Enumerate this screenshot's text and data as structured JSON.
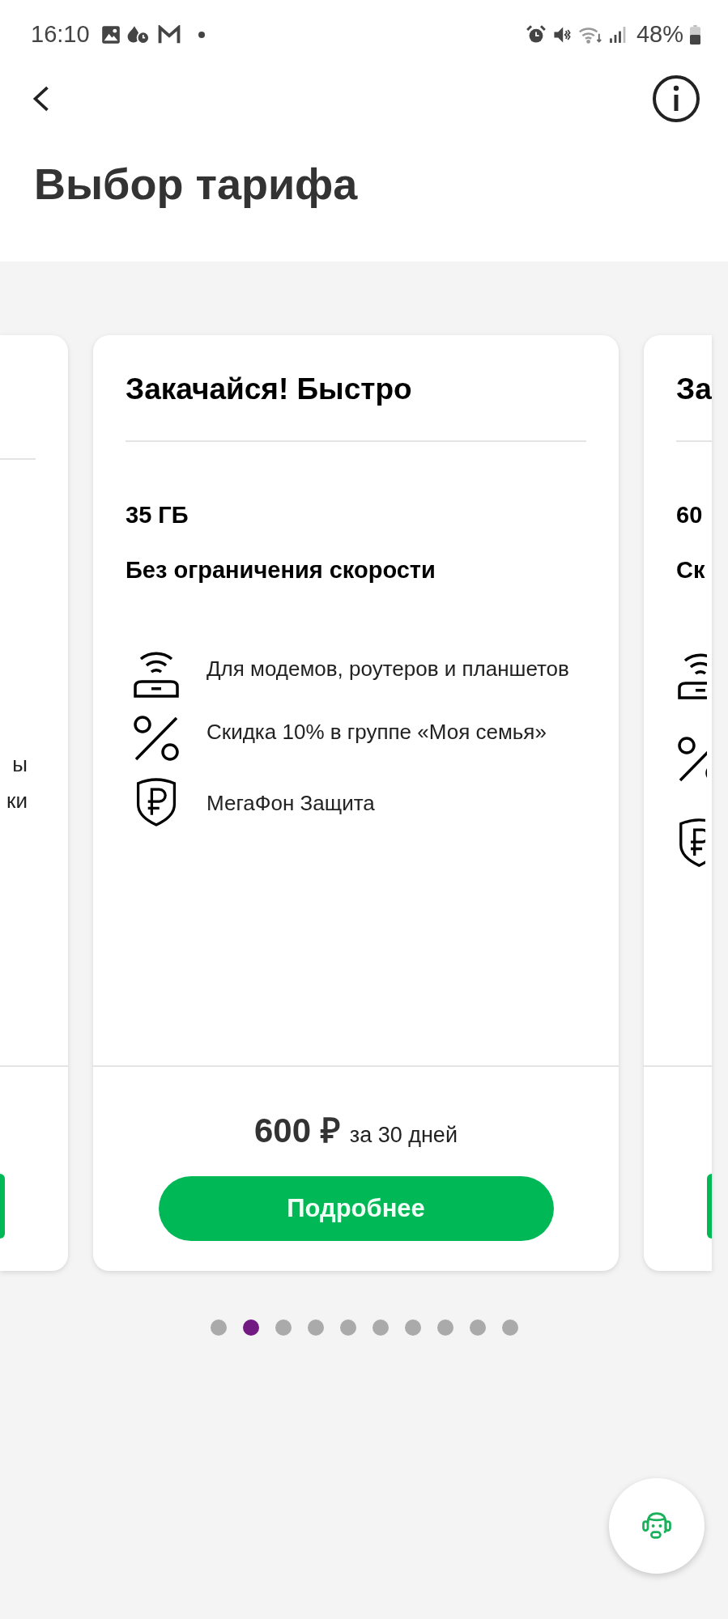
{
  "status_bar": {
    "time": "16:10",
    "battery": "48%"
  },
  "header": {
    "title": "Выбор тарифа"
  },
  "left_card": {
    "lines": [
      "ы",
      "ки"
    ]
  },
  "tariff": {
    "title": "Закачайся! Быстро",
    "data": "35 ГБ",
    "speed": "Без ограничения скорости",
    "features": [
      {
        "kind": "router",
        "text": "Для модемов, роутеров и планшетов"
      },
      {
        "kind": "percent",
        "text": "Скидка 10% в группе «Моя семья»"
      },
      {
        "kind": "shield",
        "text": "МегаФон Защита"
      }
    ],
    "price": "600 ₽",
    "period": "за 30 дней",
    "button": "Подробнее"
  },
  "right_card": {
    "title": "За",
    "data": "60",
    "speed": "Ск",
    "features": [
      {
        "kind": "router"
      },
      {
        "kind": "percent"
      },
      {
        "kind": "shield"
      }
    ]
  },
  "pager": [
    {
      "selected": false
    },
    {
      "selected": true
    },
    {
      "selected": false
    },
    {
      "selected": false
    },
    {
      "selected": false
    },
    {
      "selected": false
    },
    {
      "selected": false
    },
    {
      "selected": false
    },
    {
      "selected": false
    },
    {
      "selected": false
    }
  ]
}
